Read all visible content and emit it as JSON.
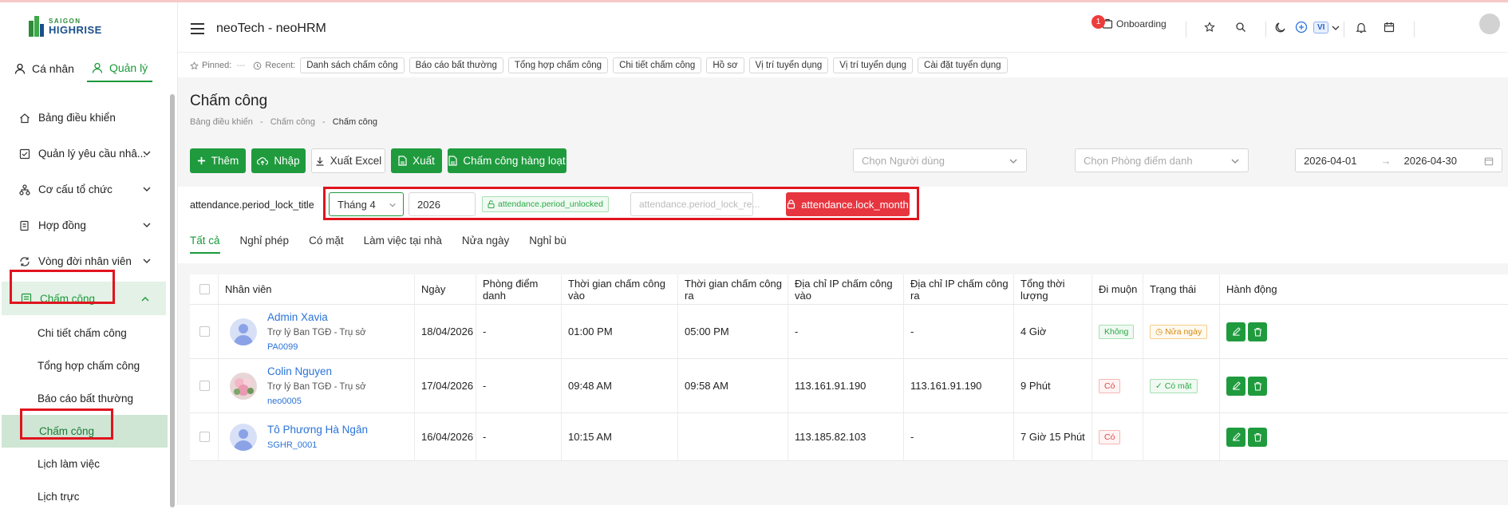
{
  "colors": {
    "brand": "#1f9b3e",
    "danger": "#e7353f",
    "highlight": "#e0141e"
  },
  "logo": {
    "line1": "SAIGON",
    "line2": "HIGHRISE"
  },
  "roles": [
    {
      "label": "Cá nhân",
      "icon": "user-icon"
    },
    {
      "label": "Quản lý",
      "icon": "manager-icon"
    }
  ],
  "sidebar": {
    "items": [
      {
        "label": "Bảng điều khiển",
        "icon": "home-icon"
      },
      {
        "label": "Quản lý yêu cầu nhâ...",
        "icon": "checkbox-icon"
      },
      {
        "label": "Cơ cấu tổ chức",
        "icon": "org-chart-icon"
      },
      {
        "label": "Hợp đồng",
        "icon": "contract-icon"
      },
      {
        "label": "Vòng đời nhân viên",
        "icon": "lifecycle-icon"
      },
      {
        "label": "Chấm công",
        "icon": "timesheet-icon"
      }
    ],
    "subitems": [
      "Chi tiết chấm công",
      "Tổng hợp chấm công",
      "Báo cáo bất thường",
      "Chấm công",
      "Lịch làm việc",
      "Lịch trực"
    ]
  },
  "header": {
    "title": "neoTech - neoHRM",
    "onboarding": "Onboarding",
    "onboarding_count": "1",
    "lang": "VI"
  },
  "recent": {
    "pinned_label": "Pinned:",
    "pinned_value": "---",
    "recent_label": "Recent:",
    "chips": [
      "Danh sách chấm công",
      "Báo cáo bất thường",
      "Tổng hợp chấm công",
      "Chi tiết chấm công",
      "Hồ sơ",
      "Vị trí tuyển dụng",
      "Vị trí tuyển dụng",
      "Cài đặt tuyển dụng"
    ]
  },
  "page": {
    "title": "Chấm công",
    "breadcrumb": [
      "Bảng điều khiển",
      "Chấm công",
      "Chấm công"
    ]
  },
  "toolbar": {
    "add": "Thêm",
    "import": "Nhập",
    "export_excel": "Xuất Excel",
    "export": "Xuất",
    "bulk": "Chấm công hàng loạt",
    "user_placeholder": "Chọn Người dùng",
    "room_placeholder": "Chọn Phòng điểm danh",
    "date_from": "2026-04-01",
    "date_to": "2026-04-30"
  },
  "lock": {
    "title": "attendance.period_lock_title",
    "month": "Tháng 4",
    "year": "2026",
    "status": "attendance.period_unlocked",
    "reason_placeholder": "attendance.period_lock_re...",
    "button": "attendance.lock_month"
  },
  "tabs": [
    "Tất cả",
    "Nghỉ phép",
    "Có mặt",
    "Làm việc tại nhà",
    "Nửa ngày",
    "Nghỉ bù"
  ],
  "table": {
    "headers": [
      "Nhân viên",
      "Ngày",
      "Phòng điểm danh",
      "Thời gian chấm công vào",
      "Thời gian chấm công ra",
      "Địa chỉ IP chấm công vào",
      "Địa chỉ IP chấm công ra",
      "Tổng thời lượng",
      "Đi muộn",
      "Trạng thái",
      "Hành động"
    ],
    "rows": [
      {
        "name": "Admin Xavia",
        "position": "Trợ lý Ban TGĐ - Trụ sở",
        "code": "PA0099",
        "date": "18/04/2026",
        "room": "-",
        "in": "01:00 PM",
        "out": "05:00 PM",
        "ip_in": "-",
        "ip_out": "-",
        "total": "4 Giờ",
        "late": "Không",
        "status": "Nửa ngày"
      },
      {
        "name": "Colin Nguyen",
        "position": "Trợ lý Ban TGĐ - Trụ sở",
        "code": "neo0005",
        "date": "17/04/2026",
        "room": "-",
        "in": "09:48 AM",
        "out": "09:58 AM",
        "ip_in": "113.161.91.190",
        "ip_out": "113.161.91.190",
        "total": "9 Phút",
        "late": "Có",
        "status": "Có mặt"
      },
      {
        "name": "Tô Phương Hà Ngân",
        "position": "",
        "code": "SGHR_0001",
        "date": "16/04/2026",
        "room": "-",
        "in": "10:15 AM",
        "out": "",
        "ip_in": "113.185.82.103",
        "ip_out": "-",
        "total": "7 Giờ 15 Phút",
        "late": "Có",
        "status": ""
      }
    ]
  }
}
